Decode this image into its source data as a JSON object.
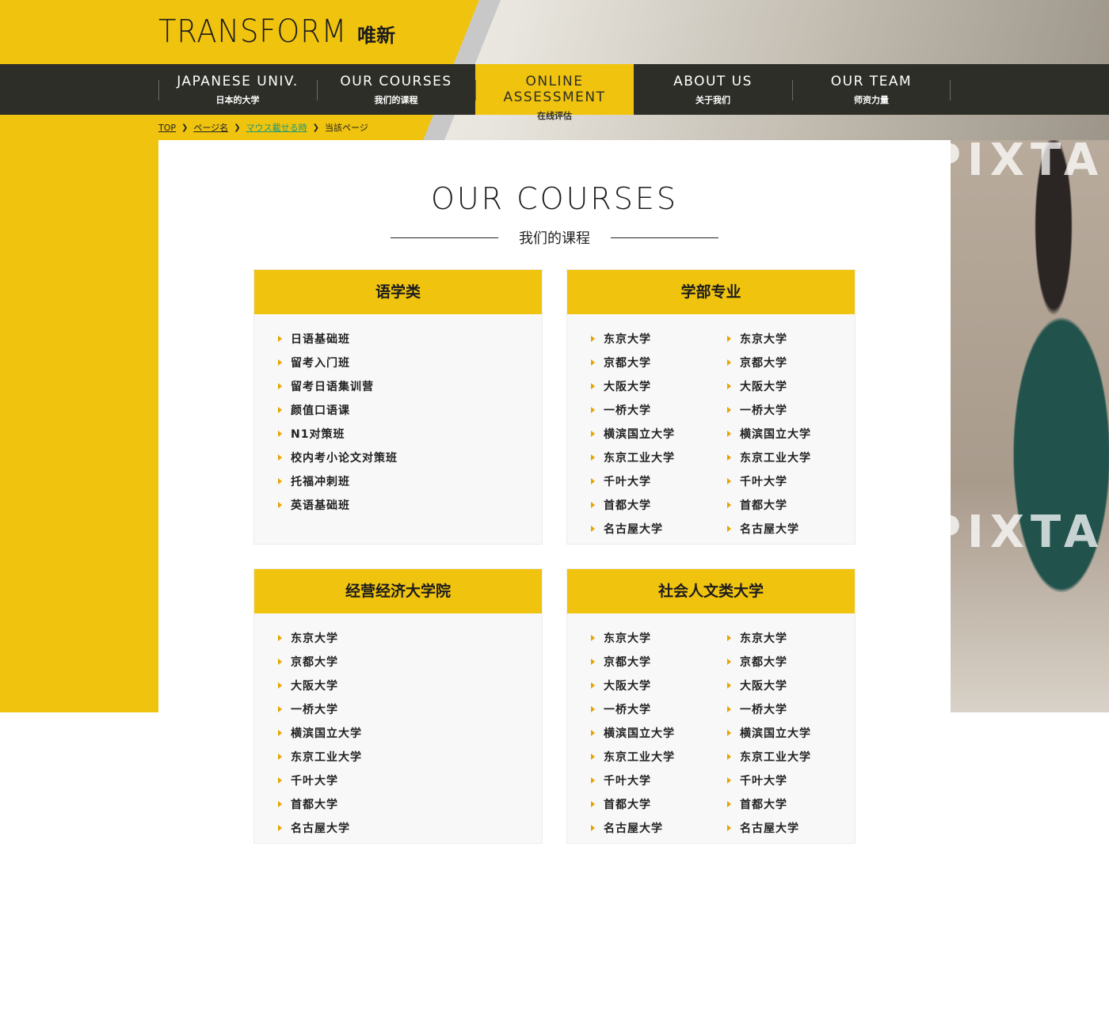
{
  "logo": {
    "en": "TRANSFORM",
    "cn": "唯新"
  },
  "nav": [
    {
      "en": "JAPANESE UNIV.",
      "cn": "日本的大学"
    },
    {
      "en": "OUR COURSES",
      "cn": "我们的课程"
    },
    {
      "en": "ONLINE ASSESSMENT",
      "cn": "在线评估",
      "active": true
    },
    {
      "en": "ABOUT US",
      "cn": "关于我们"
    },
    {
      "en": "OUR TEAM",
      "cn": "师资力量"
    }
  ],
  "breadcrumb": [
    {
      "label": "TOP"
    },
    {
      "label": "ページ名"
    },
    {
      "label": "マウス載せる時"
    },
    {
      "label": "当該ページ"
    }
  ],
  "watermark": "PIXTA",
  "page": {
    "title": "OUR COURSES",
    "subtitle": "我们的课程"
  },
  "colors": {
    "accent": "#f0c30f",
    "nav_bg": "#2d2e27",
    "bullet": "#e8a400",
    "hover_link": "#1a9a7a"
  },
  "cards": [
    {
      "title": "语学类",
      "columns": [
        [
          "日语基础班",
          "留考入门班",
          "留考日语集训营",
          "颜值口语课",
          "N1对策班",
          "校内考小论文对策班",
          "托福冲刺班",
          "英语基础班"
        ]
      ]
    },
    {
      "title": "学部专业",
      "columns": [
        [
          "东京大学",
          "京都大学",
          "大阪大学",
          "一桥大学",
          "横滨国立大学",
          "东京工业大学",
          "千叶大学",
          "首都大学",
          "名古屋大学"
        ],
        [
          "东京大学",
          "京都大学",
          "大阪大学",
          "一桥大学",
          "横滨国立大学",
          "东京工业大学",
          "千叶大学",
          "首都大学",
          "名古屋大学"
        ]
      ]
    },
    {
      "title": "经营经济大学院",
      "columns": [
        [
          "东京大学",
          "京都大学",
          "大阪大学",
          "一桥大学",
          "横滨国立大学",
          "东京工业大学",
          "千叶大学",
          "首都大学",
          "名古屋大学"
        ]
      ]
    },
    {
      "title": "社会人文类大学",
      "columns": [
        [
          "东京大学",
          "京都大学",
          "大阪大学",
          "一桥大学",
          "横滨国立大学",
          "东京工业大学",
          "千叶大学",
          "首都大学",
          "名古屋大学"
        ],
        [
          "东京大学",
          "京都大学",
          "大阪大学",
          "一桥大学",
          "横滨国立大学",
          "东京工业大学",
          "千叶大学",
          "首都大学",
          "名古屋大学"
        ]
      ]
    }
  ]
}
